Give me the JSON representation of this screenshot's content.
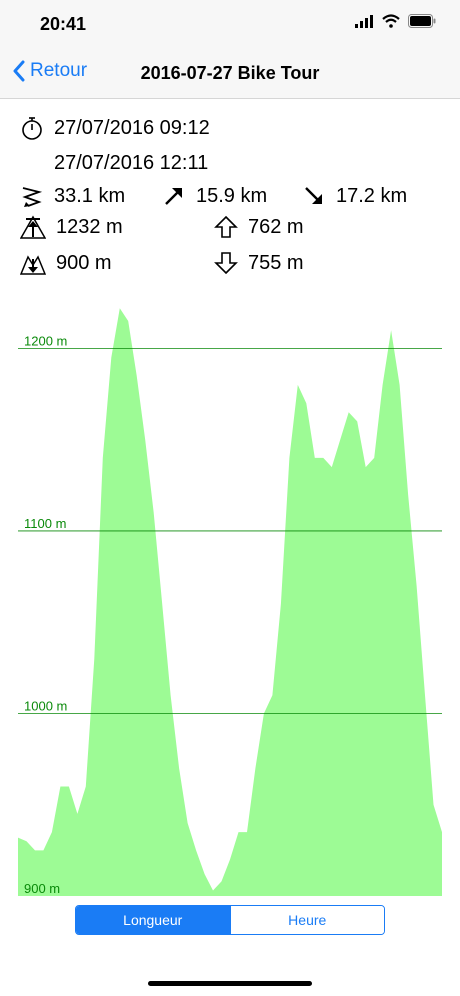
{
  "status": {
    "time": "20:41"
  },
  "nav": {
    "back_label": "Retour",
    "title": "2016-07-27 Bike Tour"
  },
  "stats": {
    "start": "27/07/2016 09:12",
    "end": "27/07/2016 12:11",
    "distance": "33.1 km",
    "distance_up": "15.9 km",
    "distance_down": "17.2 km",
    "max_altitude": "1232 m",
    "min_altitude": "900 m",
    "ascent": "762 m",
    "descent": "755 m"
  },
  "chart_data": {
    "type": "area",
    "title": "",
    "xlabel": "",
    "ylabel": "",
    "ylim": [
      900,
      1232
    ],
    "y_ticks": [
      "1200 m",
      "1100 m",
      "1000 m",
      "900 m"
    ],
    "y_tick_values": [
      1200,
      1100,
      1000,
      900
    ],
    "grid": true,
    "fill_color": "#9dfb95",
    "axis_color": "#0a8a0a",
    "x": [
      0,
      2,
      4,
      6,
      8,
      10,
      12,
      14,
      16,
      18,
      20,
      22,
      24,
      26,
      28,
      30,
      32,
      34,
      36,
      38,
      40,
      42,
      44,
      46,
      48,
      50,
      52,
      54,
      56,
      58,
      60,
      62,
      64,
      66,
      68,
      70,
      72,
      74,
      76,
      78,
      80,
      82,
      84,
      86,
      88,
      90,
      92,
      94,
      96,
      98,
      100
    ],
    "values": [
      932,
      930,
      925,
      925,
      935,
      960,
      960,
      945,
      960,
      1030,
      1140,
      1195,
      1222,
      1215,
      1185,
      1150,
      1110,
      1060,
      1010,
      970,
      940,
      925,
      912,
      903,
      908,
      920,
      935,
      935,
      970,
      1000,
      1010,
      1060,
      1140,
      1180,
      1170,
      1140,
      1140,
      1135,
      1150,
      1165,
      1160,
      1135,
      1140,
      1180,
      1210,
      1180,
      1120,
      1070,
      1010,
      950,
      935
    ],
    "series": [
      {
        "values": []
      }
    ]
  },
  "segment": {
    "options": [
      "Longueur",
      "Heure"
    ],
    "selected": "Longueur"
  }
}
